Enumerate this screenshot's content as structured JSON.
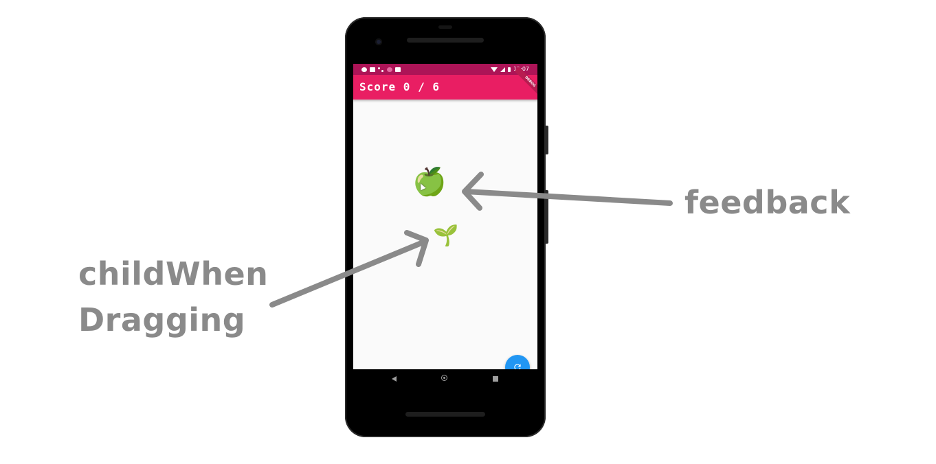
{
  "status_bar": {
    "time": "12:07"
  },
  "app_bar": {
    "title": "Score 0 / 6",
    "debug_banner": "DEBUG"
  },
  "content": {
    "dragged_item_emoji": "🍏",
    "target_item_emoji": "🌱"
  },
  "fab": {
    "icon": "refresh-icon"
  },
  "annotations": {
    "feedback_label": "feedback",
    "child_when_dragging_line1": "childWhen",
    "child_when_dragging_line2": "Dragging"
  },
  "colors": {
    "status_bar": "#ad1457",
    "app_bar": "#e91e63",
    "fab": "#2196f3",
    "annotation_gray": "#8a8a8a",
    "screen_bg": "#fafafa"
  }
}
